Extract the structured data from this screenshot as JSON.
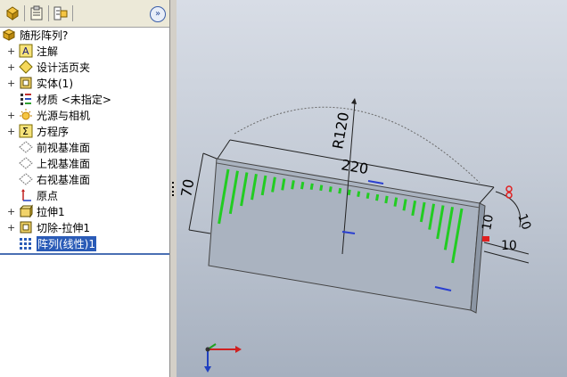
{
  "tabs": [
    {
      "name": "feature-manager-tab",
      "icon": "feature-tree-icon"
    },
    {
      "name": "property-manager-tab",
      "icon": "property-icon"
    },
    {
      "name": "configuration-manager-tab",
      "icon": "configuration-icon"
    }
  ],
  "expand_symbol": "»",
  "tree": {
    "root": {
      "label": "随形阵列?",
      "icon": "part-icon"
    },
    "items": [
      {
        "label": "注解",
        "icon": "annotation-icon",
        "expandable": true
      },
      {
        "label": "设计活页夹",
        "icon": "design-binder-icon",
        "expandable": true
      },
      {
        "label": "实体(1)",
        "icon": "solid-bodies-icon",
        "expandable": true
      },
      {
        "label": "材质 <未指定>",
        "icon": "material-icon",
        "expandable": false
      },
      {
        "label": "光源与相机",
        "icon": "lights-cameras-icon",
        "expandable": true
      },
      {
        "label": "方程序",
        "icon": "equations-icon",
        "expandable": true
      },
      {
        "label": "前视基准面",
        "icon": "plane-icon",
        "expandable": false
      },
      {
        "label": "上视基准面",
        "icon": "plane-icon",
        "expandable": false
      },
      {
        "label": "右视基准面",
        "icon": "plane-icon",
        "expandable": false
      },
      {
        "label": "原点",
        "icon": "origin-icon",
        "expandable": false
      },
      {
        "label": "拉伸1",
        "icon": "extrude-icon",
        "expandable": true
      },
      {
        "label": "切除-拉伸1",
        "icon": "cut-extrude-icon",
        "expandable": true
      },
      {
        "label": "阵列(线性)1",
        "icon": "linear-pattern-icon",
        "expandable": false,
        "selected": true
      }
    ]
  },
  "dimensions": {
    "radius": "R120",
    "length": "220",
    "height": "70",
    "edge_dim_a": "10",
    "edge_dim_b": "10",
    "edge_dim_c": "10"
  },
  "colors": {
    "selection": "#2a5bb7",
    "pattern": "#22cc22",
    "viewport_top": "#d8dde6",
    "viewport_bottom": "#a6b0bf"
  }
}
